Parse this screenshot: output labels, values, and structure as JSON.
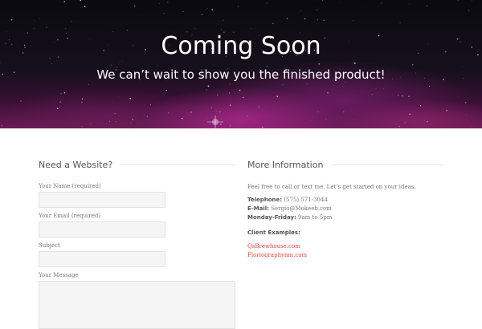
{
  "hero": {
    "title": "Coming Soon",
    "subtitle": "We can’t wait to show you the finished product!"
  },
  "contact_form": {
    "heading": "Need a Website?",
    "fields": [
      {
        "label": "Your Name (required)",
        "value": ""
      },
      {
        "label": "Your Email (required)",
        "value": ""
      },
      {
        "label": "Subject",
        "value": ""
      },
      {
        "label": "Your Message",
        "value": ""
      }
    ]
  },
  "more_info": {
    "heading": "More Information",
    "intro": "Feel free to call or text me. Let’s get started on your ideas.",
    "telephone_label": "Telephone:",
    "telephone_value": " (575) 571-3044",
    "email_label": "E-Mail:",
    "email_value": " Sergio@Mokeeb.com",
    "hours_label": "Monday-Friday:",
    "hours_value": " 9am to 5pm",
    "client_examples_label": "Client Examples:",
    "client_links": [
      "QsBrewhouse.com",
      "Floriographynm.com"
    ]
  },
  "colors": {
    "link": "#e0463a",
    "text": "#777777",
    "heading": "#555555"
  }
}
